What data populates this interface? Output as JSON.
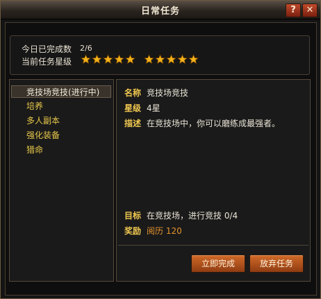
{
  "window": {
    "title": "日常任务",
    "help_label": "?",
    "close_label": "✕"
  },
  "summary": {
    "completed_label": "今日已完成数",
    "completed_value": "2/6",
    "star_level_label": "当前任务星级",
    "stars": {
      "filled": 10,
      "total": 10,
      "color": "#f2b21a"
    }
  },
  "tasks": [
    {
      "label": "竞技场竞技(进行中)",
      "active": true
    },
    {
      "label": "培养",
      "active": false
    },
    {
      "label": "多人副本",
      "active": false
    },
    {
      "label": "强化装备",
      "active": false
    },
    {
      "label": "猎命",
      "active": false
    }
  ],
  "detail": {
    "name_label": "名称",
    "name_value": "竞技场竞技",
    "star_label": "星级",
    "star_value": "4星",
    "desc_label": "描述",
    "desc_value": "在竞技场中，你可以磨练成最强者。",
    "goal_label": "目标",
    "goal_value": "在竞技场，进行竞技 0/4",
    "reward_label": "奖励",
    "reward_value": "阅历 120"
  },
  "buttons": {
    "finish_label": "立即完成",
    "abandon_label": "放弃任务"
  },
  "colors": {
    "accent_gold": "#f0c850",
    "button_orange": "#c85a20",
    "reward_orange": "#e6932c"
  }
}
